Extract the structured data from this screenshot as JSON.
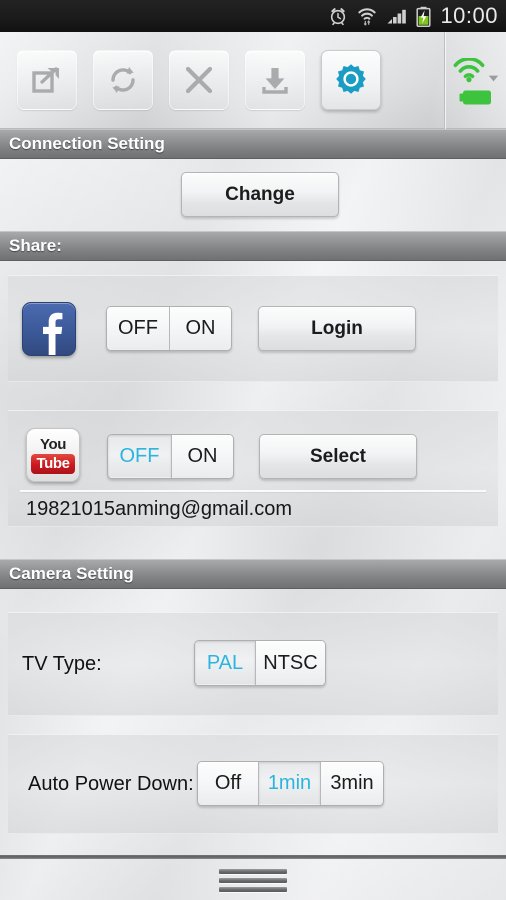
{
  "statusbar": {
    "time": "10:00",
    "icons": [
      "alarm-clock-icon",
      "wifi-icon",
      "signal-bars-icon",
      "battery-charging-icon"
    ]
  },
  "toolbar": {
    "buttons": [
      {
        "name": "share-export-button",
        "icon": "share-export-icon",
        "active": false
      },
      {
        "name": "refresh-button",
        "icon": "refresh-icon",
        "active": false
      },
      {
        "name": "close-button",
        "icon": "close-x-icon",
        "active": false
      },
      {
        "name": "download-button",
        "icon": "download-icon",
        "active": false
      },
      {
        "name": "settings-button",
        "icon": "gear-icon",
        "active": true
      }
    ],
    "status": {
      "wifi_icon": "wifi-connected-icon",
      "wifi_color": "#3ec33e",
      "battery_icon": "battery-full-icon",
      "battery_color": "#3ec33e"
    },
    "accent_color": "#1a9cc4"
  },
  "sections": {
    "connection": {
      "title": "Connection Setting",
      "change_button": "Change"
    },
    "share": {
      "title": "Share:",
      "facebook": {
        "icon": "facebook-icon",
        "brand_color": "#3b5998",
        "toggle": {
          "options": [
            "OFF",
            "ON"
          ],
          "selected": null
        },
        "action_button": "Login"
      },
      "youtube": {
        "icon": "youtube-icon",
        "brand_color": "#cc181e",
        "toggle": {
          "options": [
            "OFF",
            "ON"
          ],
          "selected": "OFF"
        },
        "action_button": "Select",
        "account": "19821015anming@gmail.com"
      }
    },
    "camera": {
      "title": "Camera Setting",
      "tv_type": {
        "label": "TV Type:",
        "options": [
          "PAL",
          "NTSC"
        ],
        "selected": "PAL"
      },
      "auto_power_down": {
        "label": "Auto Power Down:",
        "options": [
          "Off",
          "1min",
          "3min"
        ],
        "selected": "1min"
      }
    }
  },
  "bottom": {
    "handle": "drag-handle"
  },
  "colors": {
    "selected_text": "#2cb4e0",
    "header_text": "#ffffff"
  }
}
